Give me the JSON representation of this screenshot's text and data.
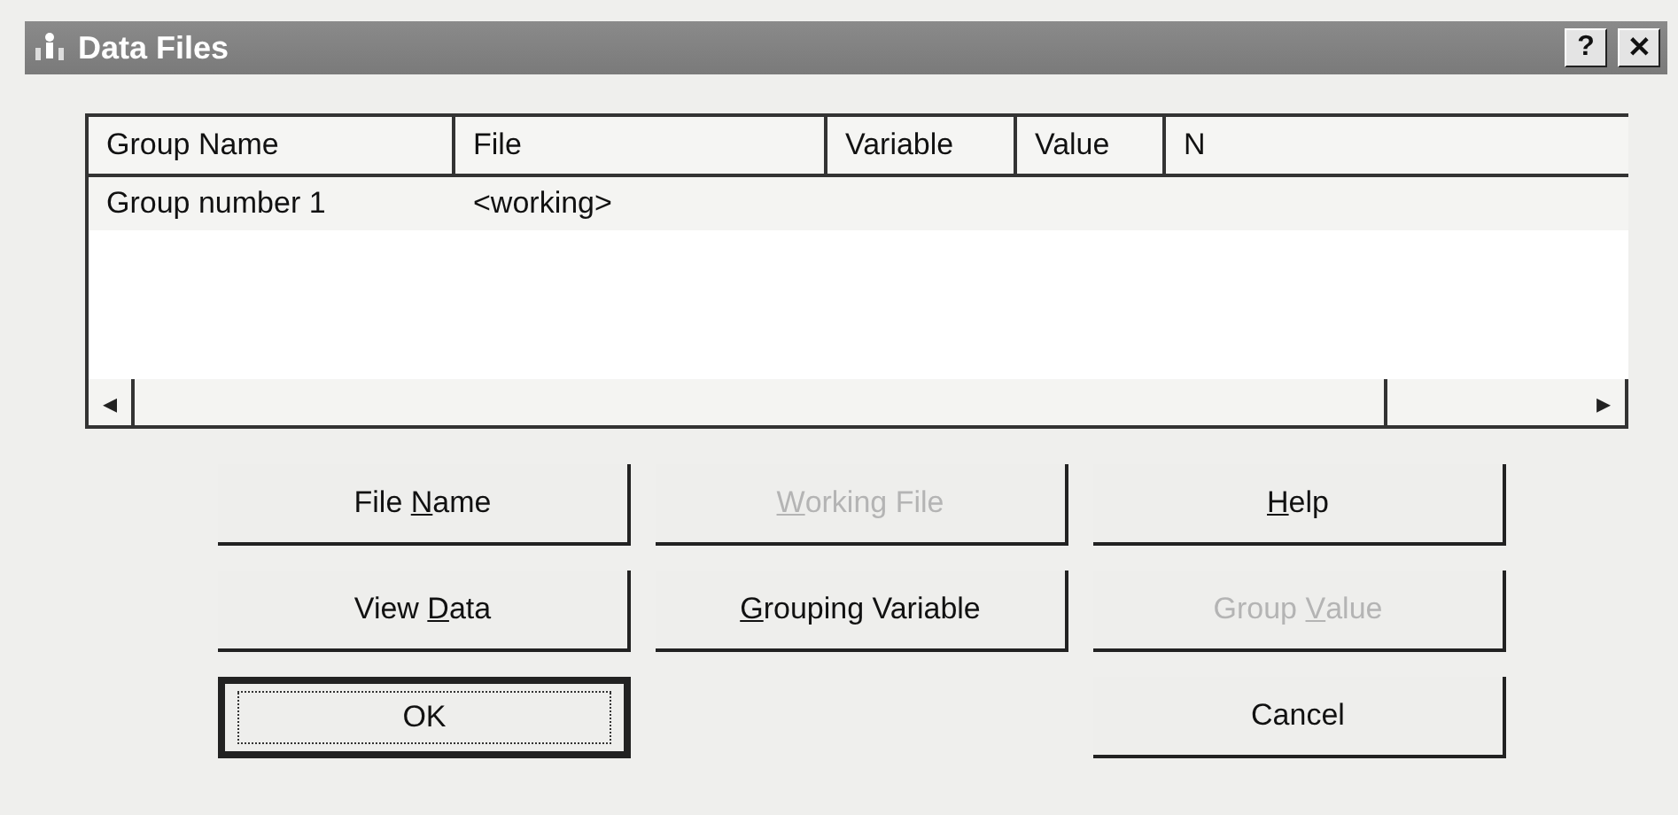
{
  "window": {
    "title": "Data Files",
    "help_button": "?",
    "close_button": "✕"
  },
  "table": {
    "columns": [
      "Group Name",
      "File",
      "Variable",
      "Value",
      "N"
    ],
    "rows": [
      [
        "Group number 1",
        "<working>"
      ]
    ]
  },
  "scroll_bar": {
    "left_arrow": "◂",
    "right_arrow": "▸"
  },
  "button_columns": [
    [
      {
        "label": [
          {
            "text": "File "
          },
          {
            "text": "N",
            "underline": true
          },
          {
            "text": "ame"
          }
        ],
        "disabled": false,
        "default": false
      },
      {
        "label": [
          {
            "text": "View "
          },
          {
            "text": "D",
            "underline": true
          },
          {
            "text": "ata"
          }
        ],
        "disabled": false,
        "default": false
      },
      {
        "label": [
          {
            "text": "OK"
          }
        ],
        "disabled": false,
        "default": true
      }
    ],
    [
      {
        "label": [
          {
            "text": "W",
            "underline": true
          },
          {
            "text": "orking File"
          }
        ],
        "disabled": true,
        "default": false
      },
      {
        "label": [
          {
            "text": "G",
            "underline": true
          },
          {
            "text": "rouping Variable"
          }
        ],
        "disabled": false,
        "default": false
      }
    ],
    [
      {
        "label": [
          {
            "text": "H",
            "underline": true
          },
          {
            "text": "elp"
          }
        ],
        "disabled": false,
        "default": false
      },
      {
        "label": [
          {
            "text": "Group "
          },
          {
            "text": "V",
            "underline": true
          },
          {
            "text": "alue"
          }
        ],
        "disabled": true,
        "default": false
      },
      {
        "label": [
          {
            "text": "Cancel"
          }
        ],
        "disabled": false,
        "default": false
      }
    ]
  ]
}
